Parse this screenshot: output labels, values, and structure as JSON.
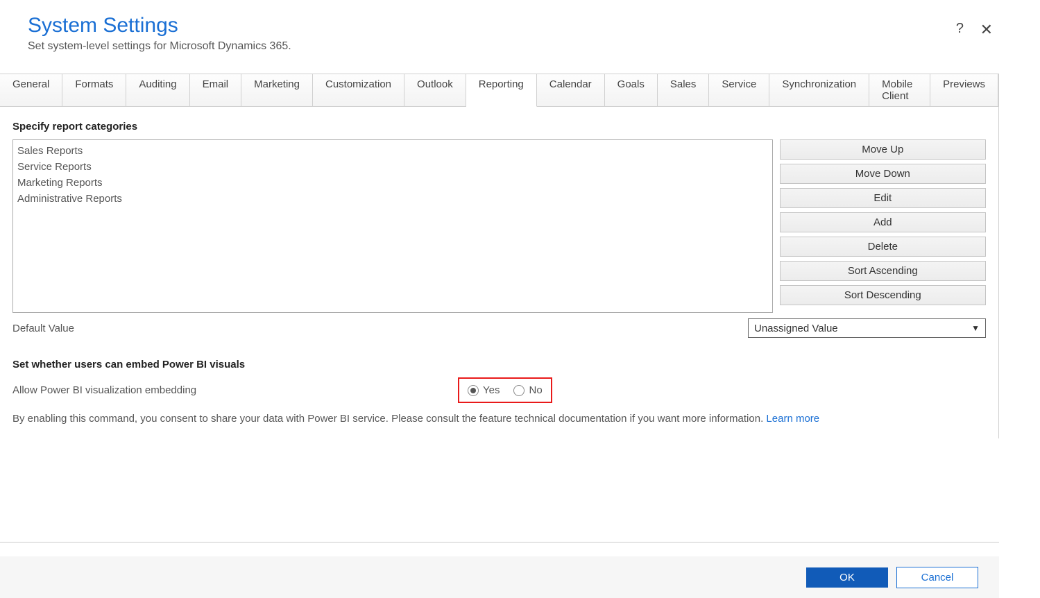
{
  "header": {
    "title": "System Settings",
    "subtitle": "Set system-level settings for Microsoft Dynamics 365."
  },
  "tabs": [
    "General",
    "Formats",
    "Auditing",
    "Email",
    "Marketing",
    "Customization",
    "Outlook",
    "Reporting",
    "Calendar",
    "Goals",
    "Sales",
    "Service",
    "Synchronization",
    "Mobile Client",
    "Previews"
  ],
  "active_tab_index": 7,
  "section1": {
    "title": "Specify report categories",
    "items": [
      "Sales Reports",
      "Service Reports",
      "Marketing Reports",
      "Administrative Reports"
    ],
    "buttons": [
      "Move Up",
      "Move Down",
      "Edit",
      "Add",
      "Delete",
      "Sort Ascending",
      "Sort Descending"
    ],
    "default_label": "Default Value",
    "default_selected": "Unassigned Value"
  },
  "section2": {
    "title": "Set whether users can embed Power BI visuals",
    "label": "Allow Power BI visualization embedding",
    "yes": "Yes",
    "no": "No",
    "selected": "yes",
    "consent": "By enabling this command, you consent to share your data with Power BI service. Please consult the feature technical documentation if you want more information. ",
    "link": "Learn more"
  },
  "footer": {
    "ok": "OK",
    "cancel": "Cancel"
  }
}
